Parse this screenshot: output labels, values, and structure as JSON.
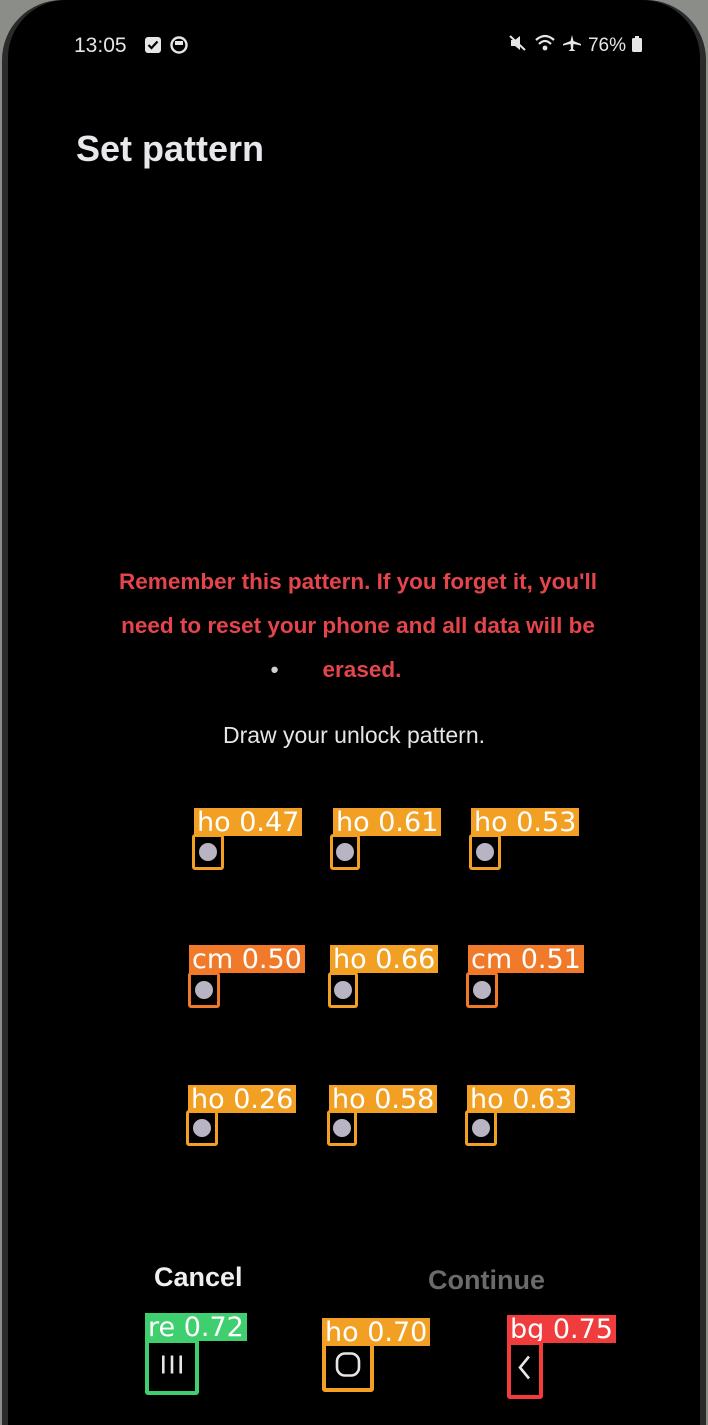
{
  "status_bar": {
    "time": "13:05",
    "battery": "76%",
    "icons": [
      "check-square-icon",
      "circle-face-icon",
      "mute-icon",
      "wifi-icon",
      "airplane-icon",
      "battery-icon"
    ]
  },
  "header": {
    "title": "Set pattern"
  },
  "warning": {
    "line1": "Remember this pattern. If you forget it, you'll",
    "line2": "need to reset your phone and all data will be",
    "line3": "erased.",
    "color": "#e4454c"
  },
  "instruction": "Draw your unlock pattern.",
  "pattern_grid": {
    "dots": [
      {
        "label": "ho 0.47",
        "class": "ho"
      },
      {
        "label": "ho 0.61",
        "class": "ho"
      },
      {
        "label": "ho 0.53",
        "class": "ho"
      },
      {
        "label": "cm 0.50",
        "class": "cm"
      },
      {
        "label": "ho 0.66",
        "class": "ho"
      },
      {
        "label": "cm 0.51",
        "class": "cm"
      },
      {
        "label": "ho 0.26",
        "class": "ho"
      },
      {
        "label": "ho 0.58",
        "class": "ho"
      },
      {
        "label": "ho 0.63",
        "class": "ho"
      }
    ]
  },
  "buttons": {
    "cancel": "Cancel",
    "continue": "Continue"
  },
  "nav_bar": {
    "recents_label": "re 0.72",
    "home_label": "ho 0.70",
    "back_label": "bg 0.75"
  },
  "colors": {
    "ho": "#f2a024",
    "cm": "#f07a2a",
    "re": "#3fcf6f",
    "bg": "#f03c3c"
  }
}
